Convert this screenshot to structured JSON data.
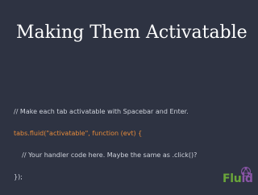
{
  "slide": {
    "title": "Making Them Activatable",
    "code_lines": [
      {
        "text": "// Make each tab activatable with Spacebar and Enter."
      },
      {
        "text": "tabs.fluid(\"activatable\", function (evt) {"
      },
      {
        "text": "    // Your handler code here. Maybe the same as .click()?"
      },
      {
        "text": "});"
      }
    ]
  },
  "logo": {
    "text_main": "Flu",
    "text_tail": "id",
    "name": "fluid-logo-icon"
  },
  "colors": {
    "background": "#2e3342",
    "title": "#ffffff",
    "code_text": "#cfd3dc",
    "code_accent": "#e58a3a",
    "logo_green": "#6aa63a",
    "logo_purple": "#8a55a6"
  }
}
